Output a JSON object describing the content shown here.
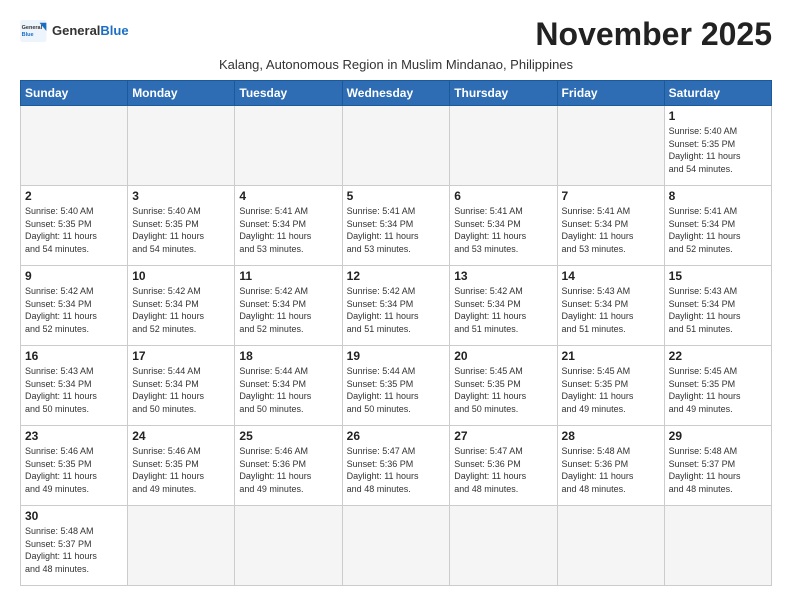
{
  "header": {
    "logo_general": "General",
    "logo_blue": "Blue",
    "month_title": "November 2025",
    "subtitle": "Kalang, Autonomous Region in Muslim Mindanao, Philippines"
  },
  "days_of_week": [
    "Sunday",
    "Monday",
    "Tuesday",
    "Wednesday",
    "Thursday",
    "Friday",
    "Saturday"
  ],
  "weeks": [
    [
      {
        "day": "",
        "info": ""
      },
      {
        "day": "",
        "info": ""
      },
      {
        "day": "",
        "info": ""
      },
      {
        "day": "",
        "info": ""
      },
      {
        "day": "",
        "info": ""
      },
      {
        "day": "",
        "info": ""
      },
      {
        "day": "1",
        "info": "Sunrise: 5:40 AM\nSunset: 5:35 PM\nDaylight: 11 hours\nand 54 minutes."
      }
    ],
    [
      {
        "day": "2",
        "info": "Sunrise: 5:40 AM\nSunset: 5:35 PM\nDaylight: 11 hours\nand 54 minutes."
      },
      {
        "day": "3",
        "info": "Sunrise: 5:40 AM\nSunset: 5:35 PM\nDaylight: 11 hours\nand 54 minutes."
      },
      {
        "day": "4",
        "info": "Sunrise: 5:41 AM\nSunset: 5:34 PM\nDaylight: 11 hours\nand 53 minutes."
      },
      {
        "day": "5",
        "info": "Sunrise: 5:41 AM\nSunset: 5:34 PM\nDaylight: 11 hours\nand 53 minutes."
      },
      {
        "day": "6",
        "info": "Sunrise: 5:41 AM\nSunset: 5:34 PM\nDaylight: 11 hours\nand 53 minutes."
      },
      {
        "day": "7",
        "info": "Sunrise: 5:41 AM\nSunset: 5:34 PM\nDaylight: 11 hours\nand 53 minutes."
      },
      {
        "day": "8",
        "info": "Sunrise: 5:41 AM\nSunset: 5:34 PM\nDaylight: 11 hours\nand 52 minutes."
      }
    ],
    [
      {
        "day": "9",
        "info": "Sunrise: 5:42 AM\nSunset: 5:34 PM\nDaylight: 11 hours\nand 52 minutes."
      },
      {
        "day": "10",
        "info": "Sunrise: 5:42 AM\nSunset: 5:34 PM\nDaylight: 11 hours\nand 52 minutes."
      },
      {
        "day": "11",
        "info": "Sunrise: 5:42 AM\nSunset: 5:34 PM\nDaylight: 11 hours\nand 52 minutes."
      },
      {
        "day": "12",
        "info": "Sunrise: 5:42 AM\nSunset: 5:34 PM\nDaylight: 11 hours\nand 51 minutes."
      },
      {
        "day": "13",
        "info": "Sunrise: 5:42 AM\nSunset: 5:34 PM\nDaylight: 11 hours\nand 51 minutes."
      },
      {
        "day": "14",
        "info": "Sunrise: 5:43 AM\nSunset: 5:34 PM\nDaylight: 11 hours\nand 51 minutes."
      },
      {
        "day": "15",
        "info": "Sunrise: 5:43 AM\nSunset: 5:34 PM\nDaylight: 11 hours\nand 51 minutes."
      }
    ],
    [
      {
        "day": "16",
        "info": "Sunrise: 5:43 AM\nSunset: 5:34 PM\nDaylight: 11 hours\nand 50 minutes."
      },
      {
        "day": "17",
        "info": "Sunrise: 5:44 AM\nSunset: 5:34 PM\nDaylight: 11 hours\nand 50 minutes."
      },
      {
        "day": "18",
        "info": "Sunrise: 5:44 AM\nSunset: 5:34 PM\nDaylight: 11 hours\nand 50 minutes."
      },
      {
        "day": "19",
        "info": "Sunrise: 5:44 AM\nSunset: 5:35 PM\nDaylight: 11 hours\nand 50 minutes."
      },
      {
        "day": "20",
        "info": "Sunrise: 5:45 AM\nSunset: 5:35 PM\nDaylight: 11 hours\nand 50 minutes."
      },
      {
        "day": "21",
        "info": "Sunrise: 5:45 AM\nSunset: 5:35 PM\nDaylight: 11 hours\nand 49 minutes."
      },
      {
        "day": "22",
        "info": "Sunrise: 5:45 AM\nSunset: 5:35 PM\nDaylight: 11 hours\nand 49 minutes."
      }
    ],
    [
      {
        "day": "23",
        "info": "Sunrise: 5:46 AM\nSunset: 5:35 PM\nDaylight: 11 hours\nand 49 minutes."
      },
      {
        "day": "24",
        "info": "Sunrise: 5:46 AM\nSunset: 5:35 PM\nDaylight: 11 hours\nand 49 minutes."
      },
      {
        "day": "25",
        "info": "Sunrise: 5:46 AM\nSunset: 5:36 PM\nDaylight: 11 hours\nand 49 minutes."
      },
      {
        "day": "26",
        "info": "Sunrise: 5:47 AM\nSunset: 5:36 PM\nDaylight: 11 hours\nand 48 minutes."
      },
      {
        "day": "27",
        "info": "Sunrise: 5:47 AM\nSunset: 5:36 PM\nDaylight: 11 hours\nand 48 minutes."
      },
      {
        "day": "28",
        "info": "Sunrise: 5:48 AM\nSunset: 5:36 PM\nDaylight: 11 hours\nand 48 minutes."
      },
      {
        "day": "29",
        "info": "Sunrise: 5:48 AM\nSunset: 5:37 PM\nDaylight: 11 hours\nand 48 minutes."
      }
    ],
    [
      {
        "day": "30",
        "info": "Sunrise: 5:48 AM\nSunset: 5:37 PM\nDaylight: 11 hours\nand 48 minutes."
      },
      {
        "day": "",
        "info": ""
      },
      {
        "day": "",
        "info": ""
      },
      {
        "day": "",
        "info": ""
      },
      {
        "day": "",
        "info": ""
      },
      {
        "day": "",
        "info": ""
      },
      {
        "day": "",
        "info": ""
      }
    ]
  ]
}
